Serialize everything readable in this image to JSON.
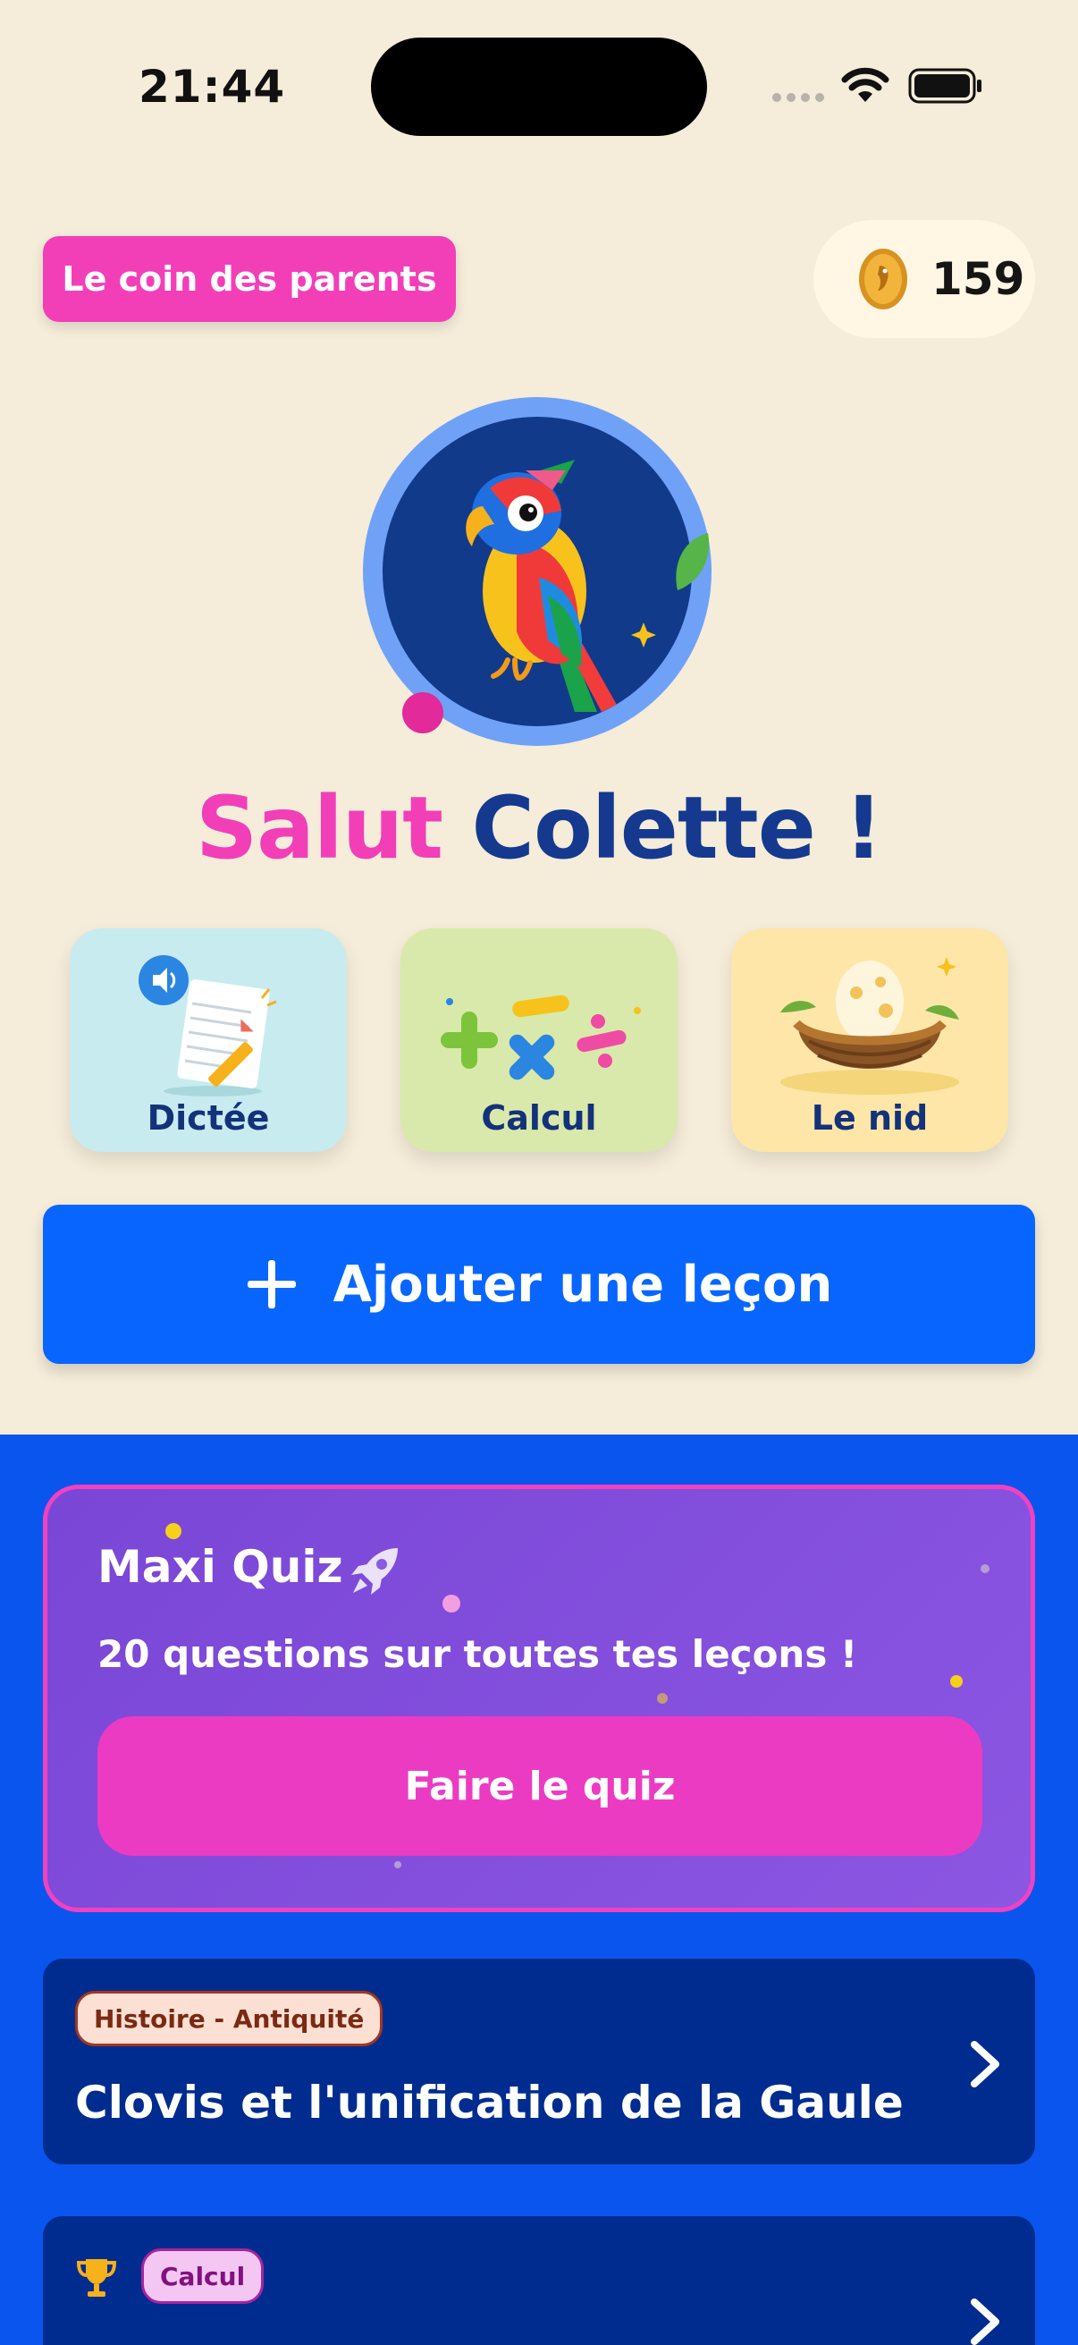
{
  "status_bar": {
    "time": "21:44"
  },
  "header": {
    "parents_button_label": "Le coin des parents",
    "coins": "159"
  },
  "greeting": {
    "hello": "Salut",
    "name": "Colette !"
  },
  "activities": [
    {
      "label": "Dictée",
      "icon": "dictation-icon"
    },
    {
      "label": "Calcul",
      "icon": "math-symbols-icon"
    },
    {
      "label": "Le nid",
      "icon": "nest-egg-icon"
    }
  ],
  "add_lesson": {
    "label": "Ajouter une leçon"
  },
  "quiz": {
    "title": "Maxi Quiz",
    "subtitle": "20 questions sur toutes tes leçons !",
    "button_label": "Faire le quiz"
  },
  "lessons": [
    {
      "tag": "Histoire - Antiquité",
      "title": "Clovis et l'unification de la Gaule"
    },
    {
      "tag": "Calcul",
      "title": ""
    }
  ],
  "colors": {
    "background": "#f5ecd9",
    "accent_pink": "#f23fb8",
    "primary_blue": "#0866ff",
    "section_blue": "#0a55ed",
    "card_navy": "#012c8f"
  }
}
